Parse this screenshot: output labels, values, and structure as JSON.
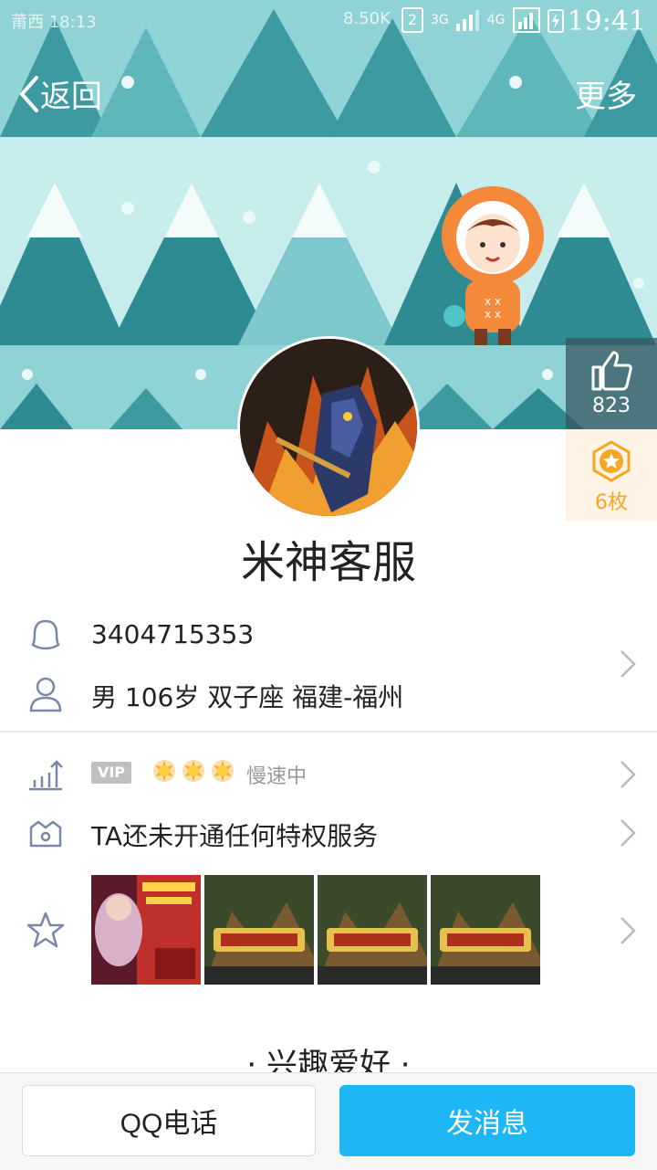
{
  "status_bar": {
    "left_text": "莆西 18:13",
    "mid_text": "8.50K",
    "sim_badge": "2",
    "net1": "3G",
    "net2": "4G",
    "time": "19:41"
  },
  "nav": {
    "back_label": "返回",
    "more_label": "更多"
  },
  "praise": {
    "count": "823"
  },
  "medals": {
    "count": "6枚"
  },
  "profile": {
    "name": "米神客服"
  },
  "info": {
    "qq_number": "3404715353",
    "details": "男  106岁  双子座  福建-福州"
  },
  "vip": {
    "badge": "VIP",
    "level_suns": 3,
    "speed": "慢速中"
  },
  "privilege": {
    "text": "TA还未开通任何特权服务"
  },
  "interest_title": "· 兴趣爱好 ·",
  "buttons": {
    "call": "QQ电话",
    "message": "发消息"
  },
  "colors": {
    "accent_blue": "#1fb6f5",
    "hero_bg": "#c6ecec",
    "tree_dark": "#2e8b92",
    "tree_mid": "#4aa9ae",
    "medal_orange": "#f5a623"
  }
}
